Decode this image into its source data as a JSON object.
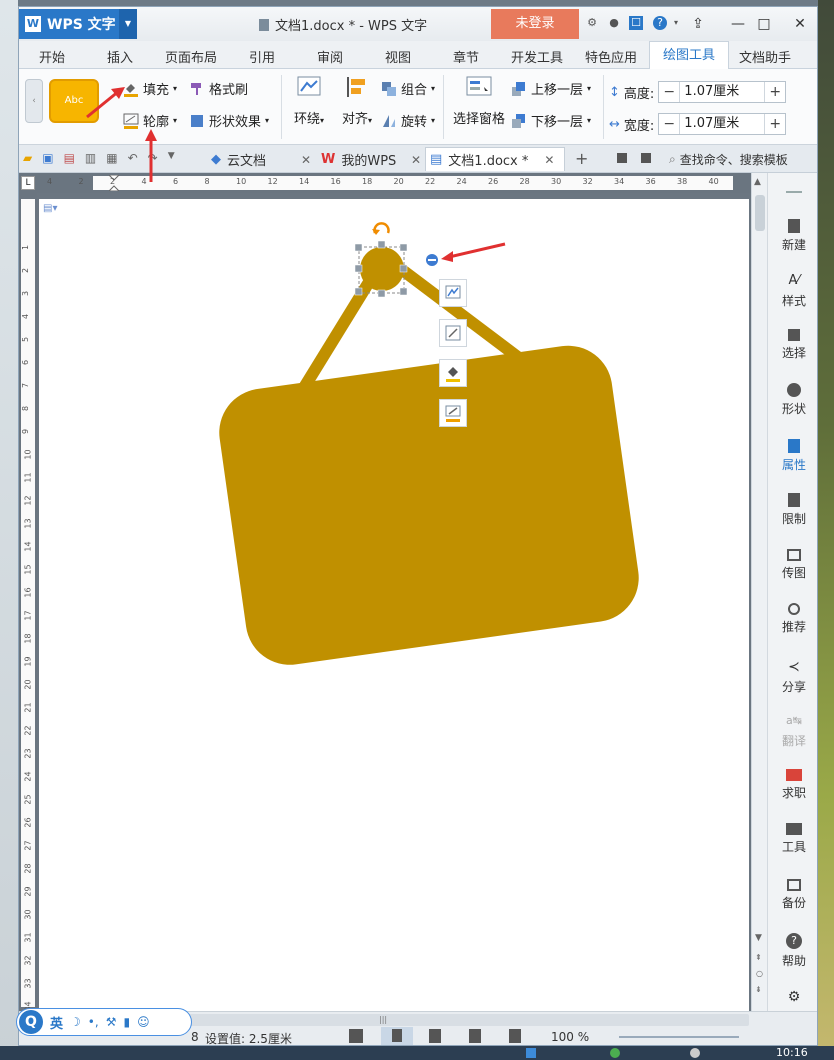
{
  "window": {
    "app_name": "WPS 文字",
    "doc_title": "文档1.docx * - WPS 文字",
    "login_label": "未登录"
  },
  "menu": {
    "items": [
      "开始",
      "插入",
      "页面布局",
      "引用",
      "审阅",
      "视图",
      "章节",
      "开发工具",
      "特色应用",
      "绘图工具",
      "文档助手"
    ],
    "active": "绘图工具"
  },
  "ribbon": {
    "style_preview": "Abc",
    "fill_label": "填充",
    "format_painter_label": "格式刷",
    "outline_label": "轮廓",
    "shape_effect_label": "形状效果",
    "wrap_label": "环绕",
    "align_label": "对齐",
    "group_label": "组合",
    "rotate_label": "旋转",
    "selection_pane_label": "选择窗格",
    "bring_forward_label": "上移一层",
    "send_backward_label": "下移一层",
    "height_label": "高度:",
    "height_value": "1.07厘米",
    "width_label": "宽度:",
    "width_value": "1.07厘米"
  },
  "tabs": {
    "items": [
      {
        "label": "云文档"
      },
      {
        "label": "我的WPS"
      },
      {
        "label": "文档1.docx *"
      }
    ],
    "search_placeholder": "查找命令、搜索模板"
  },
  "ruler": {
    "h_ticks": [
      "4",
      "2",
      "2",
      "4",
      "6",
      "8",
      "10",
      "12",
      "14",
      "16",
      "18",
      "20",
      "22",
      "24",
      "26",
      "28",
      "30",
      "32",
      "34",
      "36",
      "38",
      "40"
    ],
    "v_ticks": [
      "1",
      "2",
      "3",
      "4",
      "5",
      "6",
      "7",
      "8",
      "9",
      "10",
      "11",
      "12",
      "13",
      "14",
      "15",
      "16",
      "17",
      "18",
      "19",
      "20",
      "21",
      "22",
      "23",
      "24",
      "25",
      "26",
      "27",
      "28",
      "29",
      "30",
      "31",
      "32",
      "33",
      "34",
      "35"
    ]
  },
  "right_panel": {
    "items": [
      "新建",
      "样式",
      "选择",
      "形状",
      "属性",
      "限制",
      "传图",
      "推荐",
      "分享",
      "翻译",
      "求职",
      "工具",
      "备份",
      "帮助"
    ]
  },
  "status": {
    "page_info": "8",
    "setting_value": "设置值: 2.5厘米",
    "zoom": "100 %",
    "clock": "10:16"
  },
  "ime": {
    "logo": "Q",
    "lang": "英"
  },
  "colors": {
    "shape_fill": "#c09000",
    "accent": "#2a78c8",
    "login_bg": "#e87a5c",
    "style_gold": "#f7b500",
    "arrow_red": "#e03030"
  },
  "icons": [
    "wps-logo-icon",
    "file-icon",
    "fill-icon",
    "format-painter-icon",
    "outline-icon",
    "shape-effect-icon",
    "wrap-icon",
    "align-icon",
    "group-icon",
    "rotate-icon",
    "selection-pane-icon",
    "bring-forward-icon",
    "send-backward-icon",
    "height-icon",
    "width-icon",
    "rotate-handle-icon",
    "layout-options-icon"
  ]
}
